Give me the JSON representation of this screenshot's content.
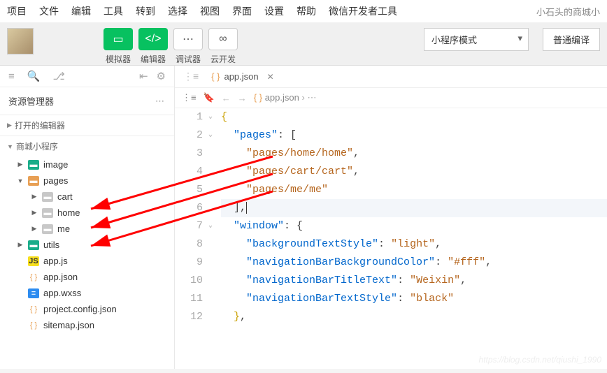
{
  "menu": [
    "项目",
    "文件",
    "编辑",
    "工具",
    "转到",
    "选择",
    "视图",
    "界面",
    "设置",
    "帮助",
    "微信开发者工具"
  ],
  "app_title": "小石头的商城小",
  "toolbar": {
    "simulator_label": "模拟器",
    "editor_label": "编辑器",
    "debugger_label": "调试器",
    "cloud_label": "云开发",
    "mode_select": "小程序模式",
    "translate": "普通编译"
  },
  "sidebar": {
    "title": "资源管理器",
    "sections": {
      "open_editors": "打开的编辑器",
      "project": "商城小程序"
    },
    "tree": [
      {
        "type": "folder",
        "open": true,
        "indent": 1,
        "icon": "folder-green",
        "label": "image"
      },
      {
        "type": "folder",
        "open": true,
        "indent": 1,
        "icon": "folder-orange",
        "label": "pages",
        "expanded": true
      },
      {
        "type": "folder",
        "open": false,
        "indent": 2,
        "icon": "folder-grey",
        "label": "cart"
      },
      {
        "type": "folder",
        "open": false,
        "indent": 2,
        "icon": "folder-grey",
        "label": "home"
      },
      {
        "type": "folder",
        "open": false,
        "indent": 2,
        "icon": "folder-grey",
        "label": "me"
      },
      {
        "type": "folder",
        "open": false,
        "indent": 1,
        "icon": "folder-green",
        "label": "utils"
      },
      {
        "type": "file",
        "indent": 1,
        "icon": "js-icon",
        "glyph": "JS",
        "label": "app.js"
      },
      {
        "type": "file",
        "indent": 1,
        "icon": "json-icon",
        "glyph": "{ }",
        "label": "app.json"
      },
      {
        "type": "file",
        "indent": 1,
        "icon": "wxss-icon",
        "glyph": "≡",
        "label": "app.wxss"
      },
      {
        "type": "file",
        "indent": 1,
        "icon": "json-icon",
        "glyph": "{ }",
        "label": "project.config.json"
      },
      {
        "type": "file",
        "indent": 1,
        "icon": "json-icon",
        "glyph": "{ }",
        "label": "sitemap.json"
      }
    ]
  },
  "editor": {
    "tab_name": "app.json",
    "breadcrumb": "app.json",
    "code_lines": [
      {
        "n": 1,
        "fold": "v",
        "tokens": [
          [
            "brace",
            "{"
          ]
        ]
      },
      {
        "n": 2,
        "fold": "v",
        "tokens": [
          [
            "punc",
            "  "
          ],
          [
            "key",
            "\"pages\""
          ],
          [
            "punc",
            ": ["
          ]
        ]
      },
      {
        "n": 3,
        "tokens": [
          [
            "punc",
            "    "
          ],
          [
            "str",
            "\"pages/home/home\""
          ],
          [
            "punc",
            ","
          ]
        ]
      },
      {
        "n": 4,
        "tokens": [
          [
            "punc",
            "    "
          ],
          [
            "str",
            "\"pages/cart/cart\""
          ],
          [
            "punc",
            ","
          ]
        ]
      },
      {
        "n": 5,
        "tokens": [
          [
            "punc",
            "    "
          ],
          [
            "str",
            "\"pages/me/me\""
          ]
        ]
      },
      {
        "n": 6,
        "hl": true,
        "tokens": [
          [
            "punc",
            "  ],"
          ],
          [
            "cursor",
            ""
          ]
        ]
      },
      {
        "n": 7,
        "fold": "v",
        "tokens": [
          [
            "punc",
            "  "
          ],
          [
            "key",
            "\"window\""
          ],
          [
            "punc",
            ": {"
          ]
        ]
      },
      {
        "n": 8,
        "tokens": [
          [
            "punc",
            "    "
          ],
          [
            "key",
            "\"backgroundTextStyle\""
          ],
          [
            "punc",
            ": "
          ],
          [
            "str",
            "\"light\""
          ],
          [
            "punc",
            ","
          ]
        ]
      },
      {
        "n": 9,
        "tokens": [
          [
            "punc",
            "    "
          ],
          [
            "key",
            "\"navigationBarBackgroundColor\""
          ],
          [
            "punc",
            ": "
          ],
          [
            "str",
            "\"#fff\""
          ],
          [
            "punc",
            ","
          ]
        ]
      },
      {
        "n": 10,
        "tokens": [
          [
            "punc",
            "    "
          ],
          [
            "key",
            "\"navigationBarTitleText\""
          ],
          [
            "punc",
            ": "
          ],
          [
            "str",
            "\"Weixin\""
          ],
          [
            "punc",
            ","
          ]
        ]
      },
      {
        "n": 11,
        "tokens": [
          [
            "punc",
            "    "
          ],
          [
            "key",
            "\"navigationBarTextStyle\""
          ],
          [
            "punc",
            ": "
          ],
          [
            "str",
            "\"black\""
          ]
        ]
      },
      {
        "n": 12,
        "tokens": [
          [
            "punc",
            "  "
          ],
          [
            "brace",
            "}"
          ],
          [
            "punc",
            ","
          ]
        ]
      }
    ]
  },
  "watermark": "https://blog.csdn.net/qiushi_1990"
}
